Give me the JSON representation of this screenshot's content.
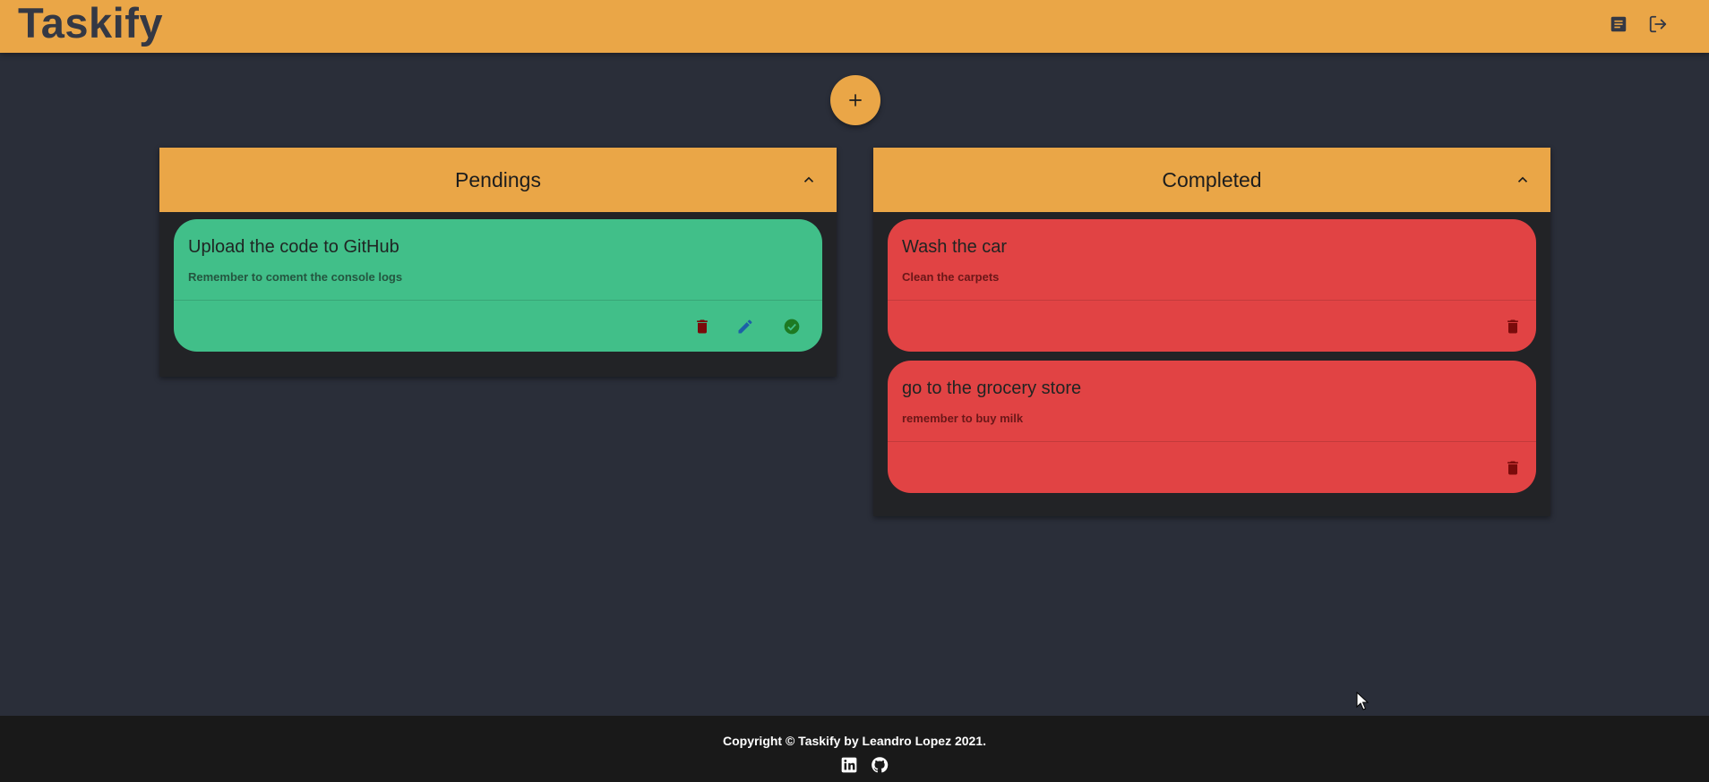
{
  "app": {
    "title": "Taskify",
    "header_icons": [
      "note-icon",
      "logout-icon"
    ]
  },
  "add_button": {
    "icon": "plus-icon"
  },
  "columns": [
    {
      "title": "Pendings",
      "color": "#41bf89",
      "tasks": [
        {
          "title": "Upload the code to GitHub",
          "description": "Remember to coment the console logs",
          "actions": [
            "delete-icon",
            "edit-icon",
            "check-icon"
          ]
        }
      ]
    },
    {
      "title": "Completed",
      "color": "#e14344",
      "tasks": [
        {
          "title": "Wash the car",
          "description": "Clean the carpets",
          "actions": [
            "delete-icon"
          ]
        },
        {
          "title": "go to the grocery store",
          "description": "remember to buy milk",
          "actions": [
            "delete-icon"
          ]
        }
      ]
    }
  ],
  "footer": {
    "copyright": "Copyright © Taskify by Leandro Lopez 2021.",
    "social_icons": [
      "linkedin-icon",
      "github-icon"
    ]
  },
  "colors": {
    "accent": "#eaa647",
    "background": "#2a2e39",
    "panel": "#222326",
    "footer": "#191919",
    "delete": "#7a0b0b",
    "edit": "#1c5fa8",
    "check": "#1d7a22"
  }
}
